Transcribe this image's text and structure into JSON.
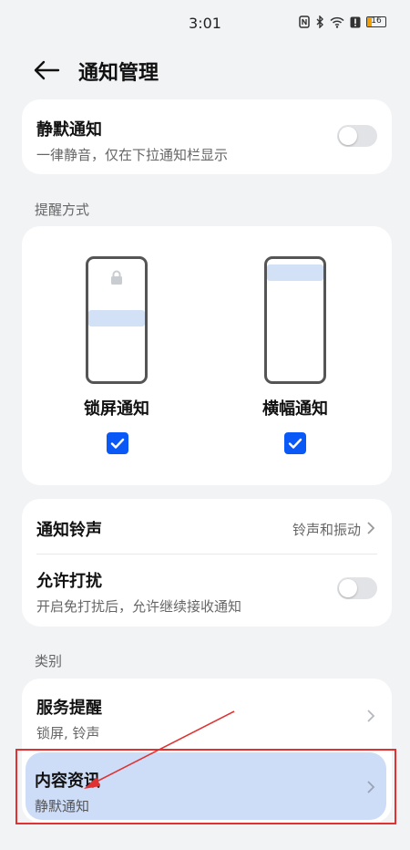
{
  "status_bar": {
    "time": "3:01",
    "battery": "16"
  },
  "header": {
    "title": "通知管理"
  },
  "silent": {
    "title": "静默通知",
    "subtitle": "一律静音，仅在下拉通知栏显示"
  },
  "reminder": {
    "section_label": "提醒方式",
    "lock_label": "锁屏通知",
    "banner_label": "横幅通知"
  },
  "ringtone": {
    "title": "通知铃声",
    "value": "铃声和振动"
  },
  "dnd": {
    "title": "允许打扰",
    "subtitle": "开启免打扰后，允许继续接收通知"
  },
  "category": {
    "section_label": "类别",
    "items": [
      {
        "title": "服务提醒",
        "subtitle": "锁屏, 铃声"
      },
      {
        "title": "内容资讯",
        "subtitle": "静默通知"
      }
    ]
  },
  "colors": {
    "accent": "#0a59f7",
    "highlight": "#cddcf7",
    "annotation": "#e03232"
  },
  "icons": [
    "back-arrow-icon",
    "lock-icon",
    "checkbox-checked-icon",
    "chevron-right-icon"
  ]
}
